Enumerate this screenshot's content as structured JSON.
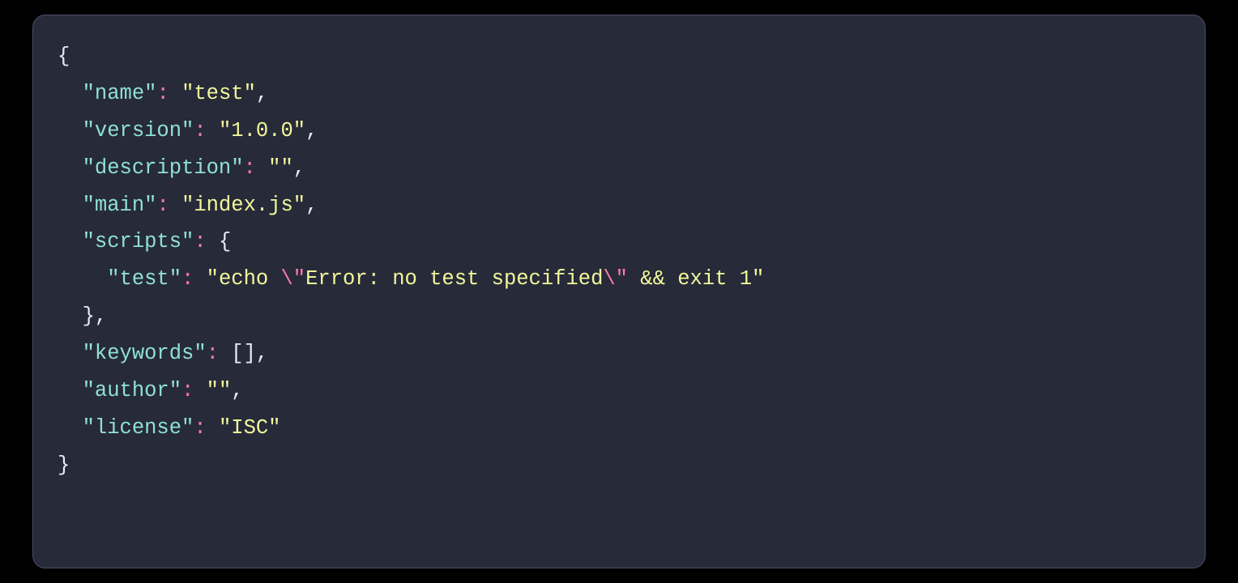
{
  "colors": {
    "background": "#000000",
    "panel": "#272a39",
    "border": "#4a4e66",
    "punctuation": "#e7e9f4",
    "key": "#8fe0d8",
    "colon": "#ff7aa8",
    "string": "#f3f79b",
    "escape": "#ff7aa8"
  },
  "language": "json",
  "tokens": [
    {
      "cls": "punct",
      "text": "{"
    },
    {
      "cls": "newline"
    },
    {
      "cls": "plain",
      "text": "  "
    },
    {
      "cls": "key",
      "text": "\"name\""
    },
    {
      "cls": "colon",
      "text": ":"
    },
    {
      "cls": "plain",
      "text": " "
    },
    {
      "cls": "string",
      "text": "\"test\""
    },
    {
      "cls": "punct",
      "text": ","
    },
    {
      "cls": "newline"
    },
    {
      "cls": "plain",
      "text": "  "
    },
    {
      "cls": "key",
      "text": "\"version\""
    },
    {
      "cls": "colon",
      "text": ":"
    },
    {
      "cls": "plain",
      "text": " "
    },
    {
      "cls": "string",
      "text": "\"1.0.0\""
    },
    {
      "cls": "punct",
      "text": ","
    },
    {
      "cls": "newline"
    },
    {
      "cls": "plain",
      "text": "  "
    },
    {
      "cls": "key",
      "text": "\"description\""
    },
    {
      "cls": "colon",
      "text": ":"
    },
    {
      "cls": "plain",
      "text": " "
    },
    {
      "cls": "string",
      "text": "\"\""
    },
    {
      "cls": "punct",
      "text": ","
    },
    {
      "cls": "newline"
    },
    {
      "cls": "plain",
      "text": "  "
    },
    {
      "cls": "key",
      "text": "\"main\""
    },
    {
      "cls": "colon",
      "text": ":"
    },
    {
      "cls": "plain",
      "text": " "
    },
    {
      "cls": "string",
      "text": "\"index.js\""
    },
    {
      "cls": "punct",
      "text": ","
    },
    {
      "cls": "newline"
    },
    {
      "cls": "plain",
      "text": "  "
    },
    {
      "cls": "key",
      "text": "\"scripts\""
    },
    {
      "cls": "colon",
      "text": ":"
    },
    {
      "cls": "plain",
      "text": " "
    },
    {
      "cls": "punct",
      "text": "{"
    },
    {
      "cls": "newline"
    },
    {
      "cls": "plain",
      "text": "    "
    },
    {
      "cls": "key",
      "text": "\"test\""
    },
    {
      "cls": "colon",
      "text": ":"
    },
    {
      "cls": "plain",
      "text": " "
    },
    {
      "cls": "string",
      "text": "\"echo "
    },
    {
      "cls": "escape",
      "text": "\\\""
    },
    {
      "cls": "string",
      "text": "Error: no test specified"
    },
    {
      "cls": "escape",
      "text": "\\\""
    },
    {
      "cls": "string",
      "text": " && exit 1\""
    },
    {
      "cls": "newline"
    },
    {
      "cls": "plain",
      "text": "  "
    },
    {
      "cls": "punct",
      "text": "},"
    },
    {
      "cls": "newline"
    },
    {
      "cls": "plain",
      "text": "  "
    },
    {
      "cls": "key",
      "text": "\"keywords\""
    },
    {
      "cls": "colon",
      "text": ":"
    },
    {
      "cls": "plain",
      "text": " "
    },
    {
      "cls": "punct",
      "text": "[],"
    },
    {
      "cls": "newline"
    },
    {
      "cls": "plain",
      "text": "  "
    },
    {
      "cls": "key",
      "text": "\"author\""
    },
    {
      "cls": "colon",
      "text": ":"
    },
    {
      "cls": "plain",
      "text": " "
    },
    {
      "cls": "string",
      "text": "\"\""
    },
    {
      "cls": "punct",
      "text": ","
    },
    {
      "cls": "newline"
    },
    {
      "cls": "plain",
      "text": "  "
    },
    {
      "cls": "key",
      "text": "\"license\""
    },
    {
      "cls": "colon",
      "text": ":"
    },
    {
      "cls": "plain",
      "text": " "
    },
    {
      "cls": "string",
      "text": "\"ISC\""
    },
    {
      "cls": "newline"
    },
    {
      "cls": "punct",
      "text": "}"
    }
  ]
}
